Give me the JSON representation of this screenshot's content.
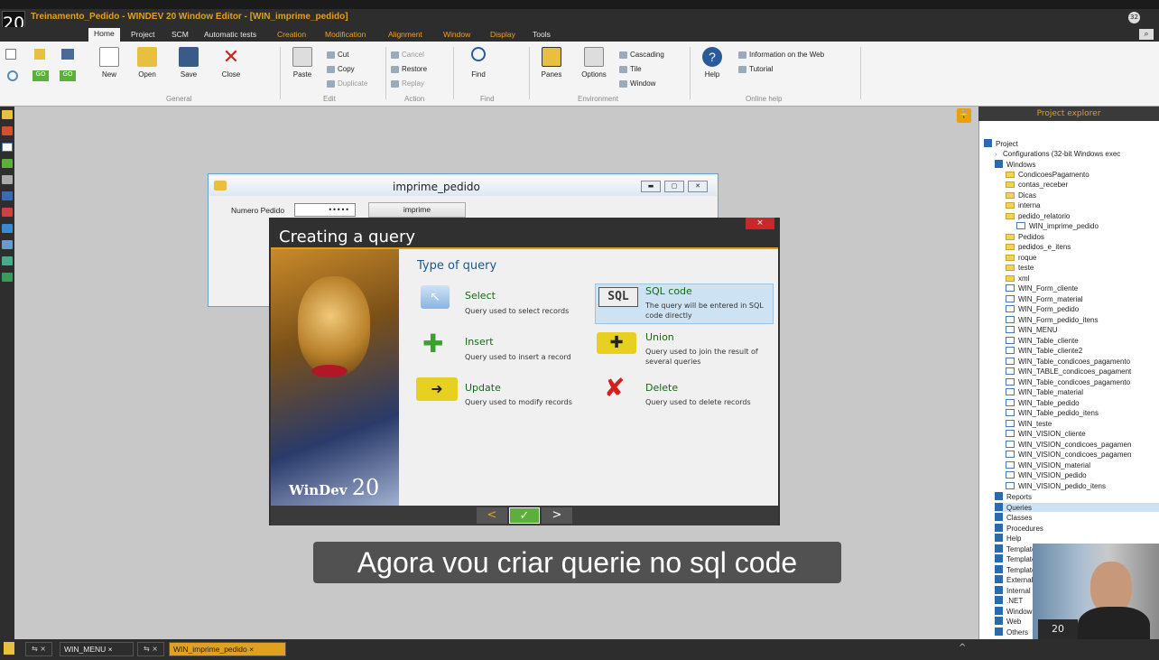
{
  "app": {
    "logo": "20",
    "title": "Treinamento_Pedido - WINDEV 20  Window Editor - [WIN_imprime_pedido]",
    "badge": "32"
  },
  "menu": {
    "tabs": [
      "Home",
      "Project",
      "SCM",
      "Automatic tests",
      "Creation",
      "Modification",
      "Alignment",
      "Window",
      "Display",
      "Tools"
    ]
  },
  "ribbon": {
    "new": "New",
    "open": "Open",
    "save": "Save",
    "close": "Close",
    "general": "General",
    "paste": "Paste",
    "cut": "Cut",
    "copy": "Copy",
    "duplicate": "Duplicate",
    "edit": "Edit",
    "cancel": "Cancel",
    "restore": "Restore",
    "replay": "Replay",
    "action": "Action",
    "find": "Find",
    "find_group": "Find",
    "panes": "Panes",
    "options": "Options",
    "cascading": "Cascading",
    "tile": "Tile",
    "window": "Window",
    "environment": "Environment",
    "help": "Help",
    "info_web": "Information on the Web",
    "tutorial": "Tutorial",
    "online_help": "Online help"
  },
  "window_editor": {
    "title": "imprime_pedido",
    "label_numero": "Numero Pedido",
    "input_value": "•••••",
    "button": "imprime"
  },
  "dialog": {
    "title": "Creating a query",
    "close": "×",
    "heading": "Type of query",
    "brand": "WinDev",
    "brand_num": "20",
    "options": {
      "select": {
        "title": "Select",
        "desc": "Query used to select records"
      },
      "sql": {
        "title": "SQL code",
        "desc": "The query will be entered in SQL code directly",
        "icon_label": "SQL"
      },
      "insert": {
        "title": "Insert",
        "desc": "Query used to insert a record"
      },
      "union": {
        "title": "Union",
        "desc": "Query used to join the result of several queries"
      },
      "update": {
        "title": "Update",
        "desc": "Query used to modify records"
      },
      "delete": {
        "title": "Delete",
        "desc": "Query used to delete records"
      }
    },
    "nav": {
      "prev": "<",
      "ok": "✓",
      "next": ">"
    }
  },
  "subtitle": "Agora vou criar querie no sql code",
  "explorer": {
    "header": "Project explorer",
    "items": [
      {
        "t": "Project",
        "k": "blu",
        "i": 0
      },
      {
        "t": "Configurations (32-bit Windows exec",
        "k": "arr",
        "i": 1
      },
      {
        "t": "Windows",
        "k": "blu",
        "i": 1
      },
      {
        "t": "CondicoesPagamento",
        "k": "fold",
        "i": 2
      },
      {
        "t": "contas_receber",
        "k": "fold",
        "i": 2
      },
      {
        "t": "Dicas",
        "k": "fold",
        "i": 2
      },
      {
        "t": "interna",
        "k": "fold",
        "i": 2
      },
      {
        "t": "pedido_relatorio",
        "k": "fold",
        "i": 2
      },
      {
        "t": "WIN_imprime_pedido",
        "k": "win",
        "i": 3
      },
      {
        "t": "Pedidos",
        "k": "fold",
        "i": 2
      },
      {
        "t": "pedidos_e_itens",
        "k": "fold",
        "i": 2
      },
      {
        "t": "roque",
        "k": "fold",
        "i": 2
      },
      {
        "t": "teste",
        "k": "fold",
        "i": 2
      },
      {
        "t": "xml",
        "k": "fold",
        "i": 2
      },
      {
        "t": "WIN_Form_cliente",
        "k": "win",
        "i": 2
      },
      {
        "t": "WIN_Form_material",
        "k": "win",
        "i": 2
      },
      {
        "t": "WIN_Form_pedido",
        "k": "win",
        "i": 2
      },
      {
        "t": "WIN_Form_pedido_itens",
        "k": "win",
        "i": 2
      },
      {
        "t": "WIN_MENU",
        "k": "win",
        "i": 2
      },
      {
        "t": "WIN_Table_cliente",
        "k": "win",
        "i": 2
      },
      {
        "t": "WIN_Table_cliente2",
        "k": "win",
        "i": 2
      },
      {
        "t": "WIN_Table_condicoes_pagamento",
        "k": "win",
        "i": 2
      },
      {
        "t": "WIN_TABLE_condicoes_pagament",
        "k": "win",
        "i": 2
      },
      {
        "t": "WIN_Table_condicoes_pagamento",
        "k": "win",
        "i": 2
      },
      {
        "t": "WIN_Table_material",
        "k": "win",
        "i": 2
      },
      {
        "t": "WIN_Table_pedido",
        "k": "win",
        "i": 2
      },
      {
        "t": "WIN_Table_pedido_itens",
        "k": "win",
        "i": 2
      },
      {
        "t": "WIN_teste",
        "k": "win",
        "i": 2
      },
      {
        "t": "WIN_VISION_cliente",
        "k": "win",
        "i": 2
      },
      {
        "t": "WIN_VISION_condicoes_pagamen",
        "k": "win",
        "i": 2
      },
      {
        "t": "WIN_VISION_condicoes_pagamen",
        "k": "win",
        "i": 2
      },
      {
        "t": "WIN_VISION_material",
        "k": "win",
        "i": 2
      },
      {
        "t": "WIN_VISION_pedido",
        "k": "win",
        "i": 2
      },
      {
        "t": "WIN_VISION_pedido_itens",
        "k": "win",
        "i": 2
      },
      {
        "t": "Reports",
        "k": "blu",
        "i": 1
      },
      {
        "t": "Queries",
        "k": "blu",
        "i": 1
      },
      {
        "t": "Classes",
        "k": "blu",
        "i": 1
      },
      {
        "t": "Procedures",
        "k": "blu",
        "i": 1
      },
      {
        "t": "Help",
        "k": "blu",
        "i": 1
      },
      {
        "t": "Templates of Windows",
        "k": "blu",
        "i": 1
      },
      {
        "t": "Templates of reports",
        "k": "blu",
        "i": 1
      },
      {
        "t": "Templates of Controls",
        "k": "blu",
        "i": 1
      },
      {
        "t": "External",
        "k": "blu",
        "i": 1
      },
      {
        "t": "Internal",
        "k": "blu",
        "i": 1
      },
      {
        "t": ".NET",
        "k": "blu",
        "i": 1
      },
      {
        "t": "Windows",
        "k": "blu",
        "i": 1
      },
      {
        "t": "Web",
        "k": "blu",
        "i": 1
      },
      {
        "t": "Others",
        "k": "blu",
        "i": 1
      }
    ]
  },
  "taskbar": {
    "tabs": [
      "WIN_MENU",
      "WIN_imprime_pedido"
    ]
  },
  "colors": {
    "accent": "#e0a020",
    "dialog_green": "#146a14",
    "close_red": "#c8282d"
  }
}
